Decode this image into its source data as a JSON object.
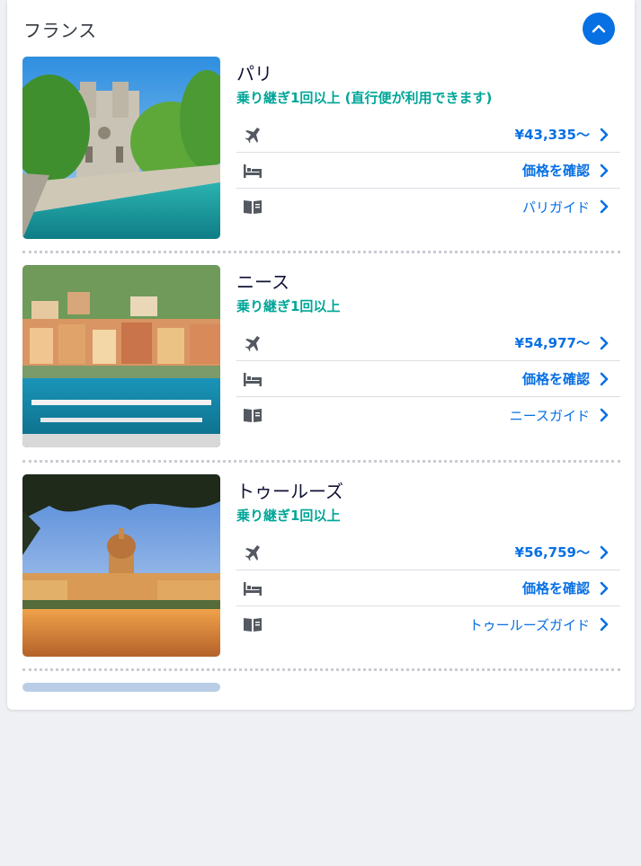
{
  "section": {
    "title": "フランス"
  },
  "destinations": [
    {
      "city": "パリ",
      "stops": "乗り継ぎ1回以上 (直行便が利用できます)",
      "flight_price": "¥43,335〜",
      "hotel_label": "価格を確認",
      "guide_label": "パリガイド"
    },
    {
      "city": "ニース",
      "stops": "乗り継ぎ1回以上",
      "flight_price": "¥54,977〜",
      "hotel_label": "価格を確認",
      "guide_label": "ニースガイド"
    },
    {
      "city": "トゥールーズ",
      "stops": "乗り継ぎ1回以上",
      "flight_price": "¥56,759〜",
      "hotel_label": "価格を確認",
      "guide_label": "トゥールーズガイド"
    }
  ],
  "colors": {
    "accent": "#0770e3",
    "stops": "#00a698",
    "text": "#111236",
    "icon": "#545860"
  },
  "icons": [
    "chevron-up-icon",
    "plane-icon",
    "bed-icon",
    "guide-book-icon",
    "chevron-right-icon"
  ]
}
